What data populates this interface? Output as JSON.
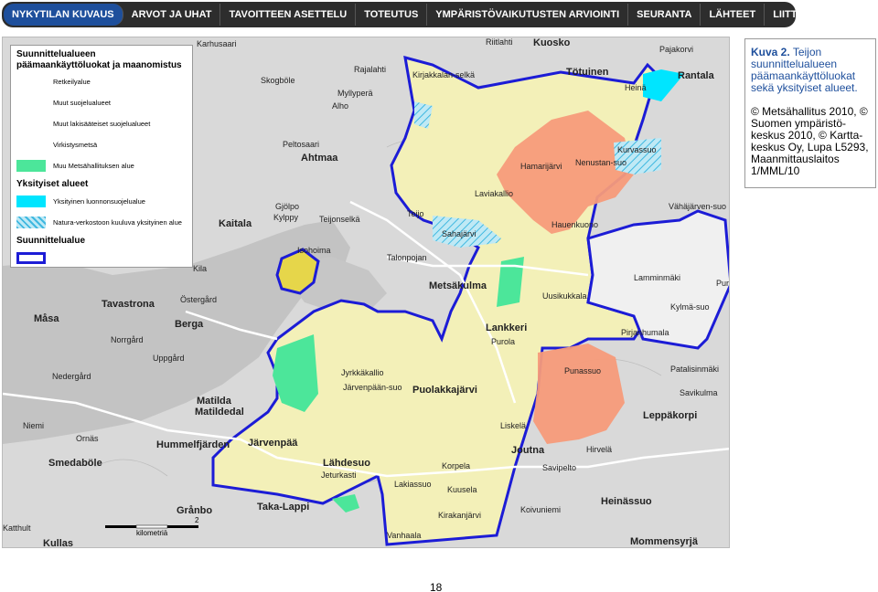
{
  "nav": {
    "items": [
      {
        "label": "NYKYTILAN KUVAUS",
        "active": true
      },
      {
        "label": "ARVOT JA UHAT"
      },
      {
        "label": "TAVOITTEEN ASETTELU"
      },
      {
        "label": "TOTEUTUS"
      },
      {
        "label": "YMPÄRISTÖVAIKUTUSTEN ARVIOINTI"
      },
      {
        "label": "SEURANTA"
      },
      {
        "label": "LÄHTEET"
      },
      {
        "label": "LIITTEET"
      }
    ]
  },
  "legend": {
    "title": "Suunnittelualueen päämaankäyttöluokat ja maanomistus",
    "items": [
      {
        "label": "Retkeilyalue",
        "color": "#ffffff"
      },
      {
        "label": "Muut suojelualueet",
        "color": "#ffffff"
      },
      {
        "label": "Muut lakisääteiset suojelualueet",
        "color": "#ffffff"
      },
      {
        "label": "Virkistysmetsä",
        "color": "#ffffff"
      },
      {
        "label": "Muu Metsähallituksen alue",
        "color": "#4ce69a"
      }
    ],
    "private_title": "Yksityiset alueet",
    "private_items": [
      {
        "label": "Yksityinen luonnonsuojelualue",
        "color": "#00e5ff"
      },
      {
        "label": "Natura-verkostoon kuuluva yksityinen alue",
        "color": "#7fd6f0"
      }
    ],
    "planning_title": "Suunnittelualue",
    "planning_color": "#1c1cd6",
    "scale_label": "kilometriä",
    "scale_value": "2"
  },
  "map": {
    "places": [
      {
        "name": "Karhusaari"
      },
      {
        "name": "Riitlahti"
      },
      {
        "name": "Kuosko"
      },
      {
        "name": "Pajakorvi"
      },
      {
        "name": "Rajalahti"
      },
      {
        "name": "Kirjakkalan-selkä"
      },
      {
        "name": "Tötuinen"
      },
      {
        "name": "Rantala"
      },
      {
        "name": "Skogböle"
      },
      {
        "name": "Myllyperä"
      },
      {
        "name": "Alho"
      },
      {
        "name": "Heinä"
      },
      {
        "name": "Peltosaari"
      },
      {
        "name": "Ahtmaa"
      },
      {
        "name": "Kurvassuo"
      },
      {
        "name": "Hamarijärvi"
      },
      {
        "name": "Nenustan-suo"
      },
      {
        "name": "Laviakallio"
      },
      {
        "name": "Gjölpo"
      },
      {
        "name": "Kylppy"
      },
      {
        "name": "Teijonselkä"
      },
      {
        "name": "Teijo"
      },
      {
        "name": "Kaitala"
      },
      {
        "name": "Sahajärvi"
      },
      {
        "name": "Hauenkuono"
      },
      {
        "name": "Vähäjärven-suo"
      },
      {
        "name": "Isohoima"
      },
      {
        "name": "Kila"
      },
      {
        "name": "Talonpojan"
      },
      {
        "name": "Lamminmäki"
      },
      {
        "name": "Tavastrona"
      },
      {
        "name": "Östergård"
      },
      {
        "name": "Metsäkulma"
      },
      {
        "name": "Uusikukkala"
      },
      {
        "name": "Kylmä-suo"
      },
      {
        "name": "Purso"
      },
      {
        "name": "Måsa"
      },
      {
        "name": "Berga"
      },
      {
        "name": "Lankkeri"
      },
      {
        "name": "Purola"
      },
      {
        "name": "Norrgård"
      },
      {
        "name": "Uppgård"
      },
      {
        "name": "Jyrkkäkallio"
      },
      {
        "name": "Pirjanhumala"
      },
      {
        "name": "Punassuo"
      },
      {
        "name": "Nedergård"
      },
      {
        "name": "Järvenpään-suo"
      },
      {
        "name": "Puolakkajärvi"
      },
      {
        "name": "Patalisinmäki"
      },
      {
        "name": "Savikulma"
      },
      {
        "name": "Matilda"
      },
      {
        "name": "Matildedal"
      },
      {
        "name": "Niemi"
      },
      {
        "name": "Ornäs"
      },
      {
        "name": "Leppäkorpi"
      },
      {
        "name": "Liskelä"
      },
      {
        "name": "Hummelfjärden"
      },
      {
        "name": "Järvenpää"
      },
      {
        "name": "Joutna"
      },
      {
        "name": "Hirvelä"
      },
      {
        "name": "Smedaböle"
      },
      {
        "name": "Lähdesuo"
      },
      {
        "name": "Korpela"
      },
      {
        "name": "Savipelto"
      },
      {
        "name": "Lakiassuo"
      },
      {
        "name": "Kuusela"
      },
      {
        "name": "Heinässuo"
      },
      {
        "name": "Jeturkasti"
      },
      {
        "name": "Taka-Lappi"
      },
      {
        "name": "Koivuniemi"
      },
      {
        "name": "Grånbo"
      },
      {
        "name": "Kirakanjärvi"
      },
      {
        "name": "Kullas"
      },
      {
        "name": "Vanhaala"
      },
      {
        "name": "Mommensyrjä"
      },
      {
        "name": "Katthult"
      }
    ]
  },
  "info": {
    "caption_bold": "Kuva 2.",
    "caption": "Teijon suunnittelualueen päämaankäyttöluokat sekä yksityiset alueet.",
    "credits": "© Metsähallitus 2010, © Suomen ympäristö-keskus 2010, © Kartta-keskus Oy, Lupa L5293, Maanmittauslaitos 1/MML/10"
  },
  "page_number": "18"
}
